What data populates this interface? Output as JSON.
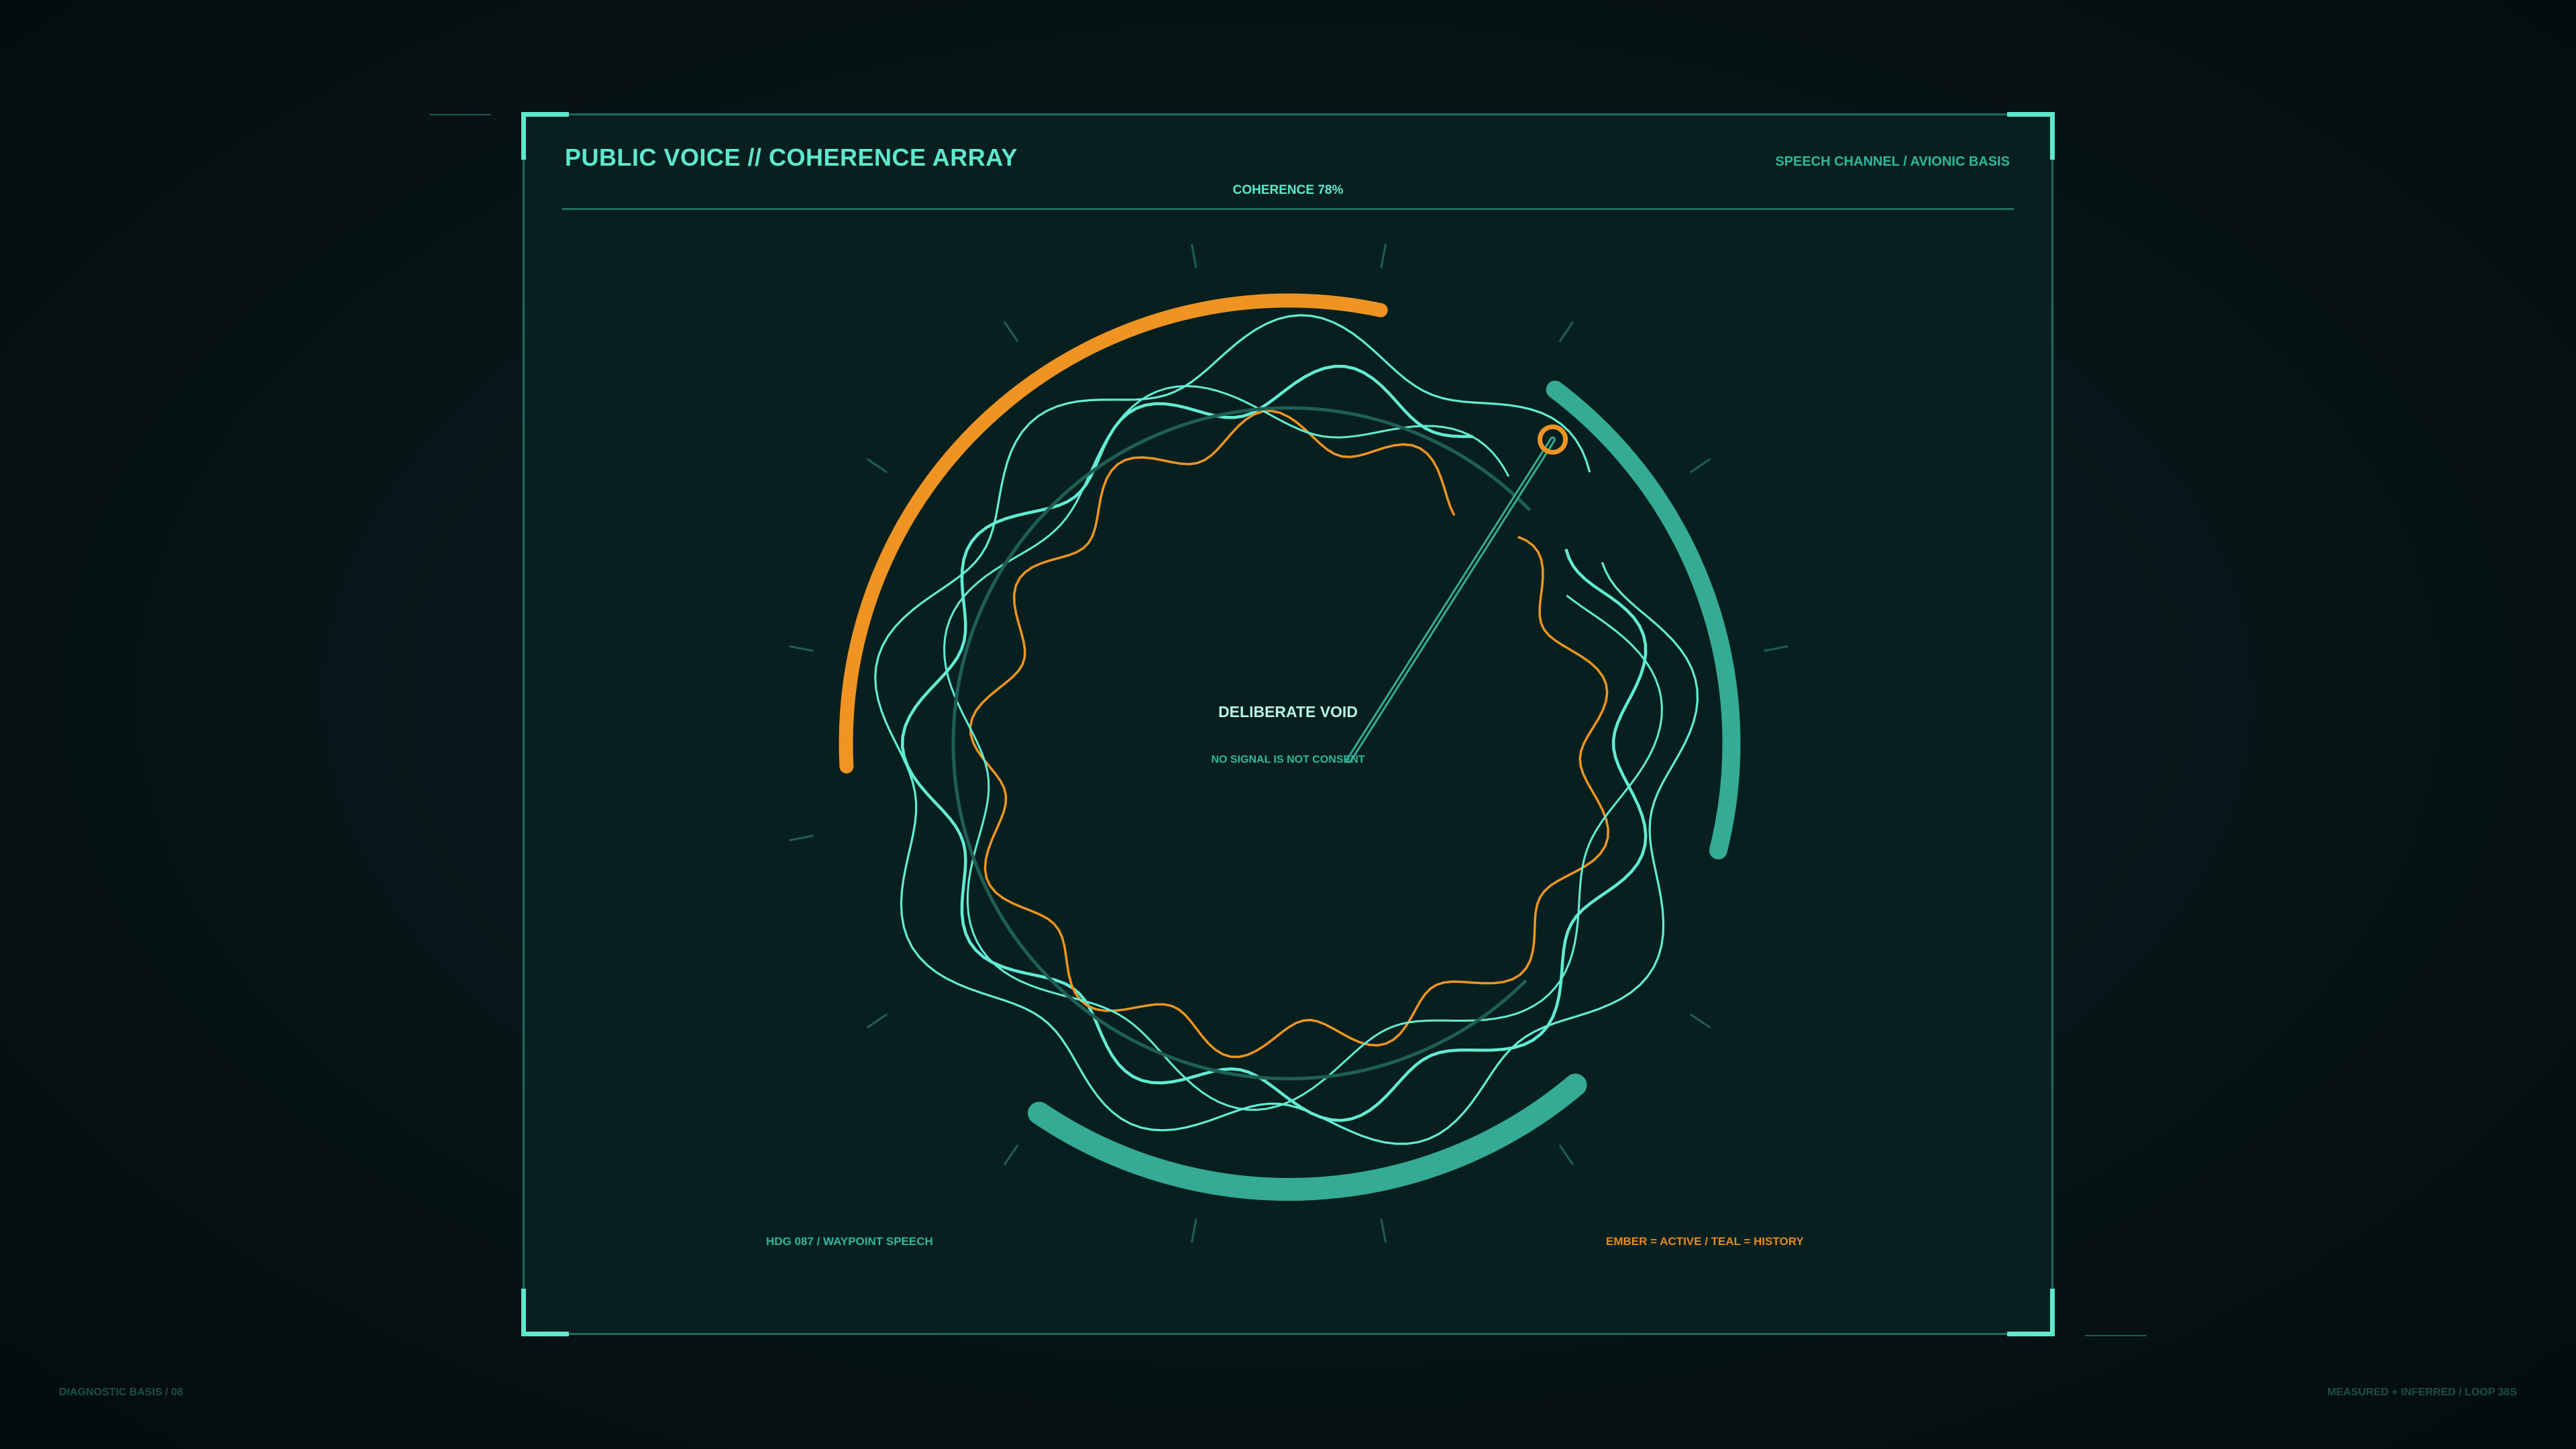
{
  "header": {
    "title": "PUBLIC VOICE // COHERENCE ARRAY",
    "channel": "SPEECH CHANNEL / AVIONIC BASIS",
    "coherence_label": "COHERENCE 78%"
  },
  "gauge": {
    "coherence_percent": 78,
    "center_title": "DELIBERATE VOID",
    "center_subtitle": "NO SIGNAL IS NOT CONSENT"
  },
  "footer": {
    "heading_label": "HDG 087 / WAYPOINT SPEECH",
    "legend_label": "EMBER = ACTIVE / TEAL = HISTORY"
  },
  "page": {
    "left_caption": "DIAGNOSTIC BASIS / 08",
    "right_caption": "MEASURED + INFERRED / LOOP 38S"
  },
  "colors": {
    "ember": "#ef9422",
    "teal": "#35ab94",
    "trace": "#63ecd2",
    "accent": "#5ee8cd"
  }
}
